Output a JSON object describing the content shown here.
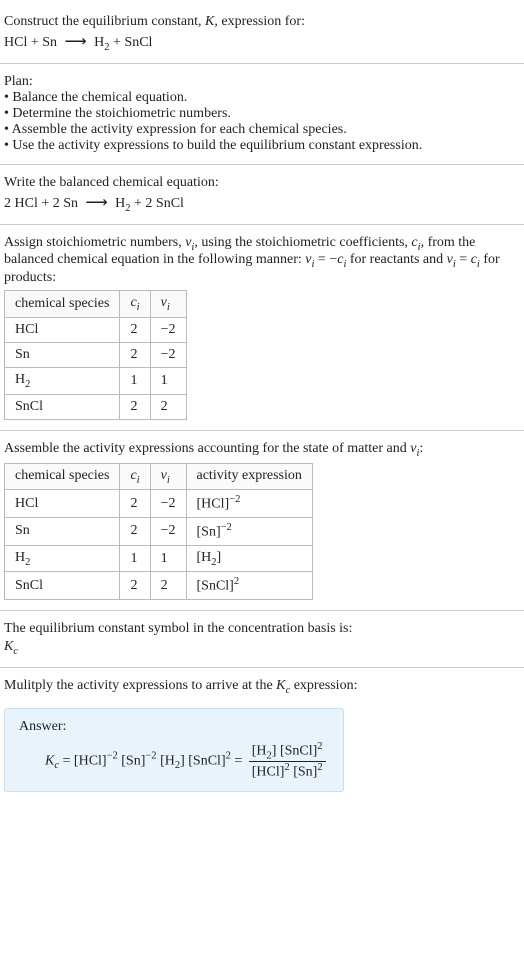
{
  "intro": {
    "line1_pre": "Construct the equilibrium constant, ",
    "line1_K": "K",
    "line1_post": ", expression for:",
    "eq_lhs1": "HCl",
    "eq_plus": " + ",
    "eq_lhs2": "Sn",
    "eq_rhs1": "H",
    "eq_rhs1_sub": "2",
    "eq_rhs2": "SnCl"
  },
  "plan": {
    "title": "Plan:",
    "b1": "• Balance the chemical equation.",
    "b2": "• Determine the stoichiometric numbers.",
    "b3": "• Assemble the activity expression for each chemical species.",
    "b4": "• Use the activity expressions to build the equilibrium constant expression."
  },
  "balanced": {
    "title": "Write the balanced chemical equation:",
    "c1": "2 HCl",
    "plus": " + ",
    "c2": "2 Sn",
    "p1": "H",
    "p1_sub": "2",
    "p2": "2 SnCl"
  },
  "stoich": {
    "text_a": "Assign stoichiometric numbers, ",
    "nu": "ν",
    "i": "i",
    "text_b": ", using the stoichiometric coefficients, ",
    "c": "c",
    "text_c": ", from the balanced chemical equation in the following manner: ",
    "eq1_lhs_nu": "ν",
    "eq1_eq": " = −",
    "eq1_c": "c",
    "text_d": " for reactants and ",
    "eq2_eq": " = ",
    "text_e": " for products:"
  },
  "table1": {
    "h_species": "chemical species",
    "h_ci_c": "c",
    "h_ci_i": "i",
    "h_nu_n": "ν",
    "h_nu_i": "i",
    "rows": [
      {
        "sp": "HCl",
        "sub": "",
        "ci": "2",
        "nu": "−2"
      },
      {
        "sp": "Sn",
        "sub": "",
        "ci": "2",
        "nu": "−2"
      },
      {
        "sp": "H",
        "sub": "2",
        "ci": "1",
        "nu": "1"
      },
      {
        "sp": "SnCl",
        "sub": "",
        "ci": "2",
        "nu": "2"
      }
    ]
  },
  "assemble": {
    "text_a": "Assemble the activity expressions accounting for the state of matter and ",
    "nu": "ν",
    "i": "i",
    "text_b": ":"
  },
  "table2": {
    "h_species": "chemical species",
    "h_ci_c": "c",
    "h_ci_i": "i",
    "h_nu_n": "ν",
    "h_nu_i": "i",
    "h_act": "activity expression",
    "rows": [
      {
        "sp": "HCl",
        "sub": "",
        "ci": "2",
        "nu": "−2",
        "act_base": "[HCl]",
        "act_exp": "−2"
      },
      {
        "sp": "Sn",
        "sub": "",
        "ci": "2",
        "nu": "−2",
        "act_base": "[Sn]",
        "act_exp": "−2"
      },
      {
        "sp": "H",
        "sub": "2",
        "ci": "1",
        "nu": "1",
        "act_base": "[H",
        "act_bsub": "2",
        "act_close": "]",
        "act_exp": ""
      },
      {
        "sp": "SnCl",
        "sub": "",
        "ci": "2",
        "nu": "2",
        "act_base": "[SnCl]",
        "act_exp": "2"
      }
    ]
  },
  "kc_intro": {
    "line": "The equilibrium constant symbol in the concentration basis is:",
    "K": "K",
    "csub": "c"
  },
  "mult": {
    "line_a": "Mulitply the activity expressions to arrive at the ",
    "K": "K",
    "csub": "c",
    "line_b": " expression:"
  },
  "answer": {
    "label": "Answer:",
    "K": "K",
    "csub": "c",
    "eq": " = ",
    "t1": "[HCl]",
    "e1": "−2",
    "t2": " [Sn]",
    "e2": "−2",
    "t3": " [H",
    "t3sub": "2",
    "t3c": "]",
    "t4": " [SnCl]",
    "e4": "2",
    "eq2": " = ",
    "num_a": "[H",
    "num_asub": "2",
    "num_ac": "] [SnCl]",
    "num_aexp": "2",
    "den_a": "[HCl]",
    "den_aexp": "2",
    "den_b": " [Sn]",
    "den_bexp": "2"
  }
}
